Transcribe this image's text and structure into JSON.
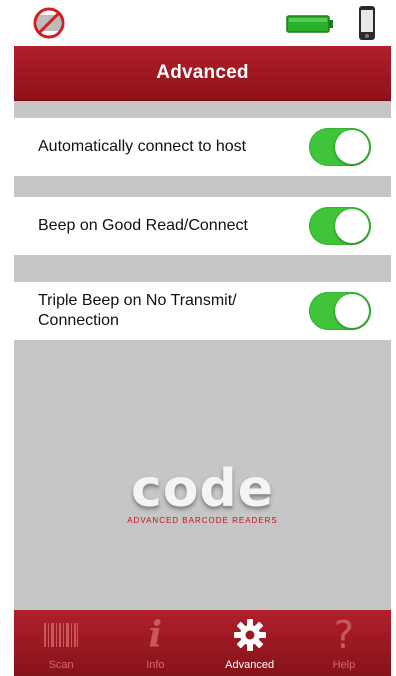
{
  "header": {
    "title": "Advanced"
  },
  "settings": [
    {
      "label": "Automatically connect to host",
      "enabled": true
    },
    {
      "label": "Beep on Good Read/Connect",
      "enabled": true
    },
    {
      "label": "Triple Beep on No Transmit/ Connection",
      "enabled": true
    }
  ],
  "logo": {
    "word": "code",
    "tagline": "ADVANCED BARCODE READERS"
  },
  "tabs": [
    {
      "label": "Scan",
      "icon": "barcode-icon"
    },
    {
      "label": "Info",
      "icon": "info-icon"
    },
    {
      "label": "Advanced",
      "icon": "gear-icon",
      "active": true
    },
    {
      "label": "Help",
      "icon": "question-icon"
    }
  ],
  "colors": {
    "brand_red": "#a3161f",
    "toggle_on": "#3fc43a",
    "battery_green": "#2bb02b"
  }
}
